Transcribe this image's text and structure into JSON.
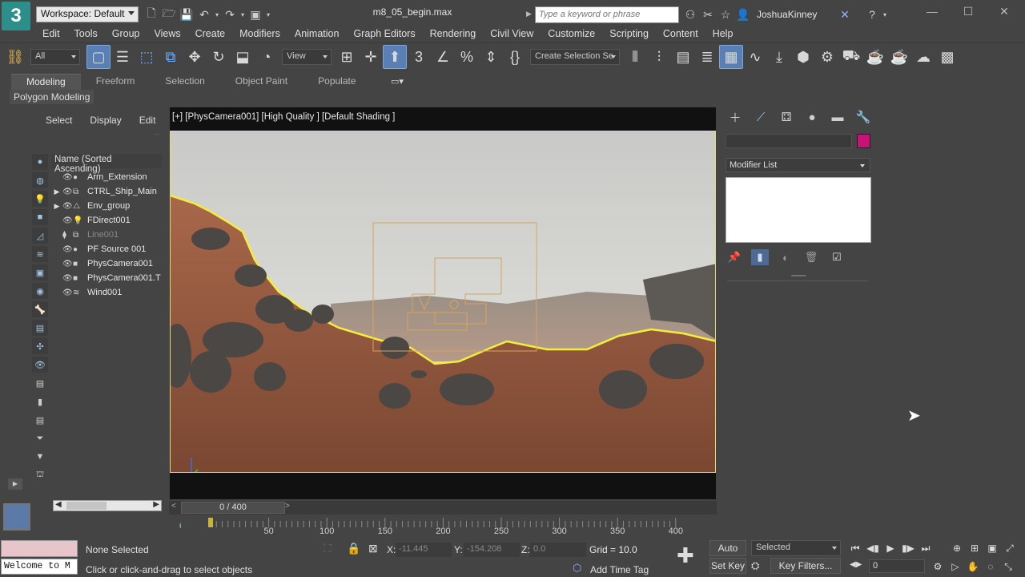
{
  "titlebar": {
    "logo": "3",
    "workspace_label": "Workspace: Default",
    "filename": "m8_05_begin.max",
    "search_placeholder": "Type a keyword or phrase",
    "username": "JoshuaKinney"
  },
  "menubar": [
    "Edit",
    "Tools",
    "Group",
    "Views",
    "Create",
    "Modifiers",
    "Animation",
    "Graph Editors",
    "Rendering",
    "Civil View",
    "Customize",
    "Scripting",
    "Content",
    "Help"
  ],
  "toolbar": {
    "selection_filter": "All",
    "ref_coord": "View",
    "named_selection": "Create Selection Se"
  },
  "ribbon": {
    "tabs": [
      "Modeling",
      "Freeform",
      "Selection",
      "Object Paint",
      "Populate"
    ],
    "active_tab": "Modeling",
    "panel_label": "Polygon Modeling"
  },
  "scene_explorer": {
    "menu": [
      "Select",
      "Display",
      "Edit"
    ],
    "header": "Name (Sorted Ascending)",
    "items": [
      {
        "name": "Arm_Extension",
        "expandable": false,
        "type": "geom",
        "dim": false
      },
      {
        "name": "CTRL_Ship_Main",
        "expandable": true,
        "type": "shape",
        "dim": false
      },
      {
        "name": "Env_group",
        "expandable": true,
        "type": "group",
        "dim": false
      },
      {
        "name": "FDirect001",
        "expandable": false,
        "type": "light",
        "dim": false
      },
      {
        "name": "Line001",
        "expandable": false,
        "type": "shape",
        "dim": true
      },
      {
        "name": "PF Source 001",
        "expandable": false,
        "type": "particle",
        "dim": false
      },
      {
        "name": "PhysCamera001",
        "expandable": false,
        "type": "camera",
        "dim": false
      },
      {
        "name": "PhysCamera001.T",
        "expandable": false,
        "type": "camera",
        "dim": false
      },
      {
        "name": "Wind001",
        "expandable": false,
        "type": "spacewarp",
        "dim": false
      }
    ]
  },
  "viewport": {
    "label": "[+] [PhysCamera001] [High Quality ] [Default Shading ]"
  },
  "timeline": {
    "slider_label": "0 / 400",
    "ticks": [
      "50",
      "100",
      "150",
      "200",
      "250",
      "300",
      "350",
      "400"
    ]
  },
  "command_panel": {
    "modifier_list": "Modifier List",
    "swatch_color": "#c8127a"
  },
  "status": {
    "maxscript_output": "Welcome to M",
    "selection": "None Selected",
    "prompt": "Click or click-and-drag to select objects",
    "x_label": "X:",
    "x_value": "-11.445",
    "y_label": "Y:",
    "y_value": "-154.208",
    "z_label": "Z:",
    "z_value": "0.0",
    "grid": "Grid = 10.0",
    "time_tag": "Add Time Tag",
    "auto_key": "Auto Key",
    "set_key": "Set Key",
    "key_mode": "Selected",
    "key_filters": "Key Filters...",
    "frame": "0"
  }
}
